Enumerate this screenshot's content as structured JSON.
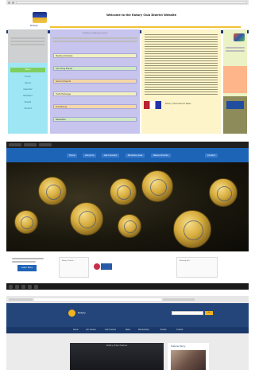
{
  "shot1": {
    "logo_text": "Rotary",
    "title": "Welcome to the Rotary Club District Website",
    "left_menu": {
      "heading": "Menu",
      "links": [
        "Home",
        "About",
        "Calendar",
        "Members",
        "Events",
        "Contact"
      ]
    },
    "center": {
      "heading": "Club News and Announcements",
      "boxes": [
        "Meeting Schedule",
        "Upcoming Events",
        "Service Projects",
        "Youth Exchange",
        "Fundraising",
        "Newsletter"
      ]
    },
    "mid_caption": "Rotary International News",
    "colors": {
      "left": "#9fe6f4",
      "center": "#c7c4ee",
      "mid": "#fdf5c9",
      "right": "#ebf2c6",
      "nav": "#1d3a78"
    }
  },
  "shot2": {
    "nav": [
      "Home",
      "About Us",
      "Get Involved",
      "Members Area",
      "News & Events",
      "Contact"
    ],
    "button": "Learn More",
    "cards": [
      "Rotary Club of ...",
      "Meeting Info"
    ],
    "colors": {
      "nav": "#1d63b6",
      "hero_dark": "#1a170d"
    }
  },
  "shot3": {
    "brand": "Rotary",
    "search_button": "Go",
    "menu": [
      "About",
      "Our Causes",
      "Get Involved",
      "News",
      "Membership",
      "Events",
      "Contact"
    ],
    "video_title": "Rotary Video Feature",
    "side_title": "Featured Story",
    "colors": {
      "header": "#234579",
      "menu": "#1a3869",
      "accent": "#f2b21c"
    }
  }
}
